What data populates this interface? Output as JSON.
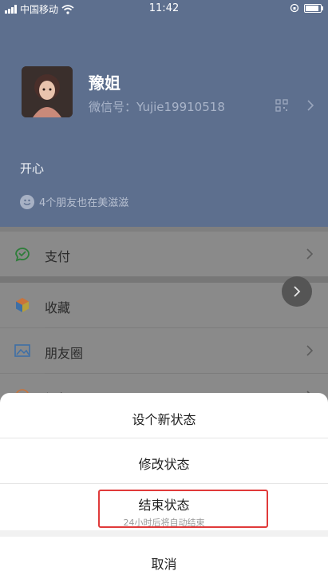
{
  "status_bar": {
    "carrier": "中国移动",
    "time": "11:42"
  },
  "profile": {
    "name": "豫姐",
    "wechat_id": "微信号：Yujie19910518",
    "status": "开心",
    "friends_text": "4个朋友也在美滋滋"
  },
  "menu": {
    "pay": "支付",
    "favorites": "收藏",
    "moments": "朋友圈",
    "channels": "视频号"
  },
  "sheet": {
    "set_new": "设个新状态",
    "modify": "修改状态",
    "end": "结束状态",
    "end_sub": "24小时后将自动结束",
    "cancel": "取消"
  },
  "colors": {
    "highlight": "#e03a3a",
    "header": "#5d6f8e"
  }
}
